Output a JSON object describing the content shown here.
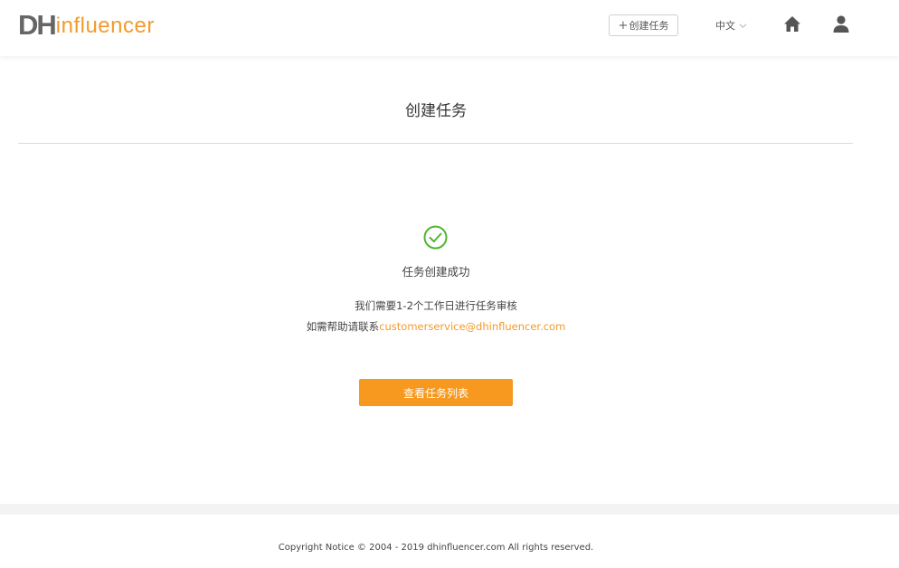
{
  "header": {
    "logo_part1": "DH",
    "logo_part2": "influencer",
    "create_button_plus": "+",
    "create_button_label": "创建任务",
    "language": "中文"
  },
  "main": {
    "title": "创建任务",
    "success_message": "任务创建成功",
    "info_line1": "我们需要1-2个工作日进行任务审核",
    "help_prefix": "如需帮助请联系",
    "help_email": "customerservice@dhinfluencer.com",
    "view_tasks_button": "查看任务列表"
  },
  "footer": {
    "copyright": "Copyright Notice © 2004 - 2019 dhinfluencer.com All rights reserved."
  },
  "colors": {
    "brand_orange": "#f39a2b",
    "button_orange": "#f7981f",
    "success_green": "#52b52f"
  },
  "icons": {
    "home": "home-icon",
    "user": "user-icon",
    "success": "check-circle-icon",
    "chevron": "chevron-down-icon"
  }
}
